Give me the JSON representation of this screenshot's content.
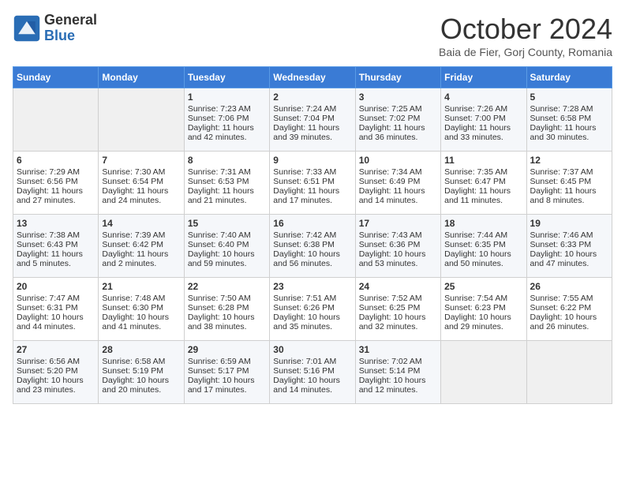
{
  "header": {
    "logo_general": "General",
    "logo_blue": "Blue",
    "month_title": "October 2024",
    "subtitle": "Baia de Fier, Gorj County, Romania"
  },
  "days_of_week": [
    "Sunday",
    "Monday",
    "Tuesday",
    "Wednesday",
    "Thursday",
    "Friday",
    "Saturday"
  ],
  "weeks": [
    [
      {
        "day": "",
        "sunrise": "",
        "sunset": "",
        "daylight": ""
      },
      {
        "day": "",
        "sunrise": "",
        "sunset": "",
        "daylight": ""
      },
      {
        "day": "1",
        "sunrise": "Sunrise: 7:23 AM",
        "sunset": "Sunset: 7:06 PM",
        "daylight": "Daylight: 11 hours and 42 minutes."
      },
      {
        "day": "2",
        "sunrise": "Sunrise: 7:24 AM",
        "sunset": "Sunset: 7:04 PM",
        "daylight": "Daylight: 11 hours and 39 minutes."
      },
      {
        "day": "3",
        "sunrise": "Sunrise: 7:25 AM",
        "sunset": "Sunset: 7:02 PM",
        "daylight": "Daylight: 11 hours and 36 minutes."
      },
      {
        "day": "4",
        "sunrise": "Sunrise: 7:26 AM",
        "sunset": "Sunset: 7:00 PM",
        "daylight": "Daylight: 11 hours and 33 minutes."
      },
      {
        "day": "5",
        "sunrise": "Sunrise: 7:28 AM",
        "sunset": "Sunset: 6:58 PM",
        "daylight": "Daylight: 11 hours and 30 minutes."
      }
    ],
    [
      {
        "day": "6",
        "sunrise": "Sunrise: 7:29 AM",
        "sunset": "Sunset: 6:56 PM",
        "daylight": "Daylight: 11 hours and 27 minutes."
      },
      {
        "day": "7",
        "sunrise": "Sunrise: 7:30 AM",
        "sunset": "Sunset: 6:54 PM",
        "daylight": "Daylight: 11 hours and 24 minutes."
      },
      {
        "day": "8",
        "sunrise": "Sunrise: 7:31 AM",
        "sunset": "Sunset: 6:53 PM",
        "daylight": "Daylight: 11 hours and 21 minutes."
      },
      {
        "day": "9",
        "sunrise": "Sunrise: 7:33 AM",
        "sunset": "Sunset: 6:51 PM",
        "daylight": "Daylight: 11 hours and 17 minutes."
      },
      {
        "day": "10",
        "sunrise": "Sunrise: 7:34 AM",
        "sunset": "Sunset: 6:49 PM",
        "daylight": "Daylight: 11 hours and 14 minutes."
      },
      {
        "day": "11",
        "sunrise": "Sunrise: 7:35 AM",
        "sunset": "Sunset: 6:47 PM",
        "daylight": "Daylight: 11 hours and 11 minutes."
      },
      {
        "day": "12",
        "sunrise": "Sunrise: 7:37 AM",
        "sunset": "Sunset: 6:45 PM",
        "daylight": "Daylight: 11 hours and 8 minutes."
      }
    ],
    [
      {
        "day": "13",
        "sunrise": "Sunrise: 7:38 AM",
        "sunset": "Sunset: 6:43 PM",
        "daylight": "Daylight: 11 hours and 5 minutes."
      },
      {
        "day": "14",
        "sunrise": "Sunrise: 7:39 AM",
        "sunset": "Sunset: 6:42 PM",
        "daylight": "Daylight: 11 hours and 2 minutes."
      },
      {
        "day": "15",
        "sunrise": "Sunrise: 7:40 AM",
        "sunset": "Sunset: 6:40 PM",
        "daylight": "Daylight: 10 hours and 59 minutes."
      },
      {
        "day": "16",
        "sunrise": "Sunrise: 7:42 AM",
        "sunset": "Sunset: 6:38 PM",
        "daylight": "Daylight: 10 hours and 56 minutes."
      },
      {
        "day": "17",
        "sunrise": "Sunrise: 7:43 AM",
        "sunset": "Sunset: 6:36 PM",
        "daylight": "Daylight: 10 hours and 53 minutes."
      },
      {
        "day": "18",
        "sunrise": "Sunrise: 7:44 AM",
        "sunset": "Sunset: 6:35 PM",
        "daylight": "Daylight: 10 hours and 50 minutes."
      },
      {
        "day": "19",
        "sunrise": "Sunrise: 7:46 AM",
        "sunset": "Sunset: 6:33 PM",
        "daylight": "Daylight: 10 hours and 47 minutes."
      }
    ],
    [
      {
        "day": "20",
        "sunrise": "Sunrise: 7:47 AM",
        "sunset": "Sunset: 6:31 PM",
        "daylight": "Daylight: 10 hours and 44 minutes."
      },
      {
        "day": "21",
        "sunrise": "Sunrise: 7:48 AM",
        "sunset": "Sunset: 6:30 PM",
        "daylight": "Daylight: 10 hours and 41 minutes."
      },
      {
        "day": "22",
        "sunrise": "Sunrise: 7:50 AM",
        "sunset": "Sunset: 6:28 PM",
        "daylight": "Daylight: 10 hours and 38 minutes."
      },
      {
        "day": "23",
        "sunrise": "Sunrise: 7:51 AM",
        "sunset": "Sunset: 6:26 PM",
        "daylight": "Daylight: 10 hours and 35 minutes."
      },
      {
        "day": "24",
        "sunrise": "Sunrise: 7:52 AM",
        "sunset": "Sunset: 6:25 PM",
        "daylight": "Daylight: 10 hours and 32 minutes."
      },
      {
        "day": "25",
        "sunrise": "Sunrise: 7:54 AM",
        "sunset": "Sunset: 6:23 PM",
        "daylight": "Daylight: 10 hours and 29 minutes."
      },
      {
        "day": "26",
        "sunrise": "Sunrise: 7:55 AM",
        "sunset": "Sunset: 6:22 PM",
        "daylight": "Daylight: 10 hours and 26 minutes."
      }
    ],
    [
      {
        "day": "27",
        "sunrise": "Sunrise: 6:56 AM",
        "sunset": "Sunset: 5:20 PM",
        "daylight": "Daylight: 10 hours and 23 minutes."
      },
      {
        "day": "28",
        "sunrise": "Sunrise: 6:58 AM",
        "sunset": "Sunset: 5:19 PM",
        "daylight": "Daylight: 10 hours and 20 minutes."
      },
      {
        "day": "29",
        "sunrise": "Sunrise: 6:59 AM",
        "sunset": "Sunset: 5:17 PM",
        "daylight": "Daylight: 10 hours and 17 minutes."
      },
      {
        "day": "30",
        "sunrise": "Sunrise: 7:01 AM",
        "sunset": "Sunset: 5:16 PM",
        "daylight": "Daylight: 10 hours and 14 minutes."
      },
      {
        "day": "31",
        "sunrise": "Sunrise: 7:02 AM",
        "sunset": "Sunset: 5:14 PM",
        "daylight": "Daylight: 10 hours and 12 minutes."
      },
      {
        "day": "",
        "sunrise": "",
        "sunset": "",
        "daylight": ""
      },
      {
        "day": "",
        "sunrise": "",
        "sunset": "",
        "daylight": ""
      }
    ]
  ]
}
